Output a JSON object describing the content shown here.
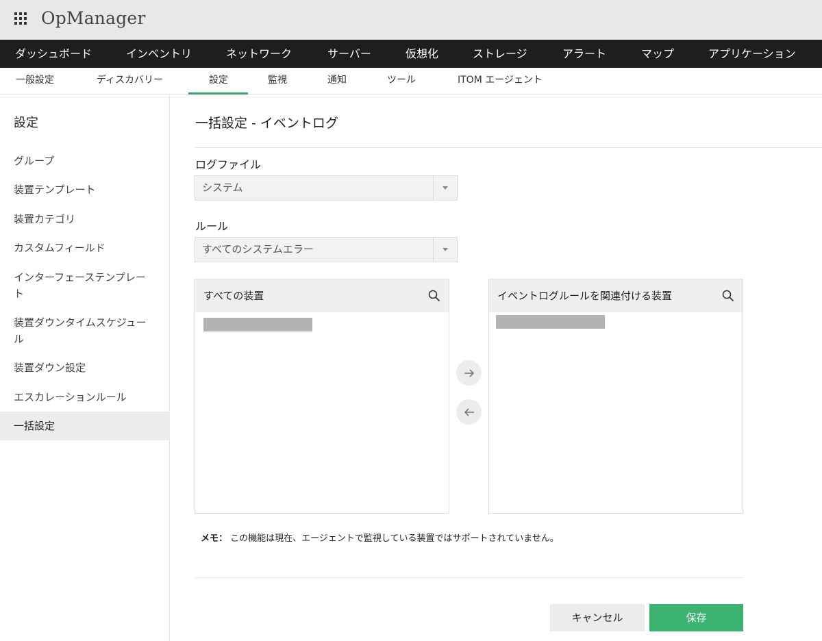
{
  "app": {
    "title": "OpManager"
  },
  "main_nav": [
    "ダッシュボード",
    "インベントリ",
    "ネットワーク",
    "サーバー",
    "仮想化",
    "ストレージ",
    "アラート",
    "マップ",
    "アプリケーション"
  ],
  "sub_nav": {
    "items": [
      "一般設定",
      "ディスカバリー",
      "設定",
      "監視",
      "通知",
      "ツール",
      "ITOM エージェント"
    ],
    "active": "設定"
  },
  "sidebar": {
    "title": "設定",
    "items": [
      {
        "label": "グループ"
      },
      {
        "label": "装置テンプレート"
      },
      {
        "label": "装置カテゴリ"
      },
      {
        "label": "カスタムフィールド"
      },
      {
        "label": "インターフェーステンプレート"
      },
      {
        "label": "装置ダウンタイムスケジュール"
      },
      {
        "label": "装置ダウン設定"
      },
      {
        "label": "エスカレーションルール"
      },
      {
        "label": "一括設定",
        "active": true
      }
    ]
  },
  "page": {
    "title": "一括設定 - イベントログ",
    "log_file": {
      "label": "ログファイル",
      "value": "システム"
    },
    "rule": {
      "label": "ルール",
      "value": "すべてのシステムエラー"
    },
    "available_panel": {
      "title": "すべての装置"
    },
    "selected_panel": {
      "title": "イベントログルールを関連付ける装置"
    },
    "memo": {
      "label": "メモ：",
      "text": "この機能は現在、エージェントで監視している装置ではサポートされていません。"
    },
    "buttons": {
      "cancel": "キャンセル",
      "save": "保存"
    }
  },
  "colors": {
    "accent": "#3cb371",
    "nav_bg": "#1e1e1e",
    "header_bg": "#e8e8e8"
  },
  "icons": {
    "app_menu": "grid-icon",
    "search": "search-icon",
    "move_right": "arrow-right-icon",
    "move_left": "arrow-left-icon",
    "dropdown": "chevron-down-icon"
  }
}
